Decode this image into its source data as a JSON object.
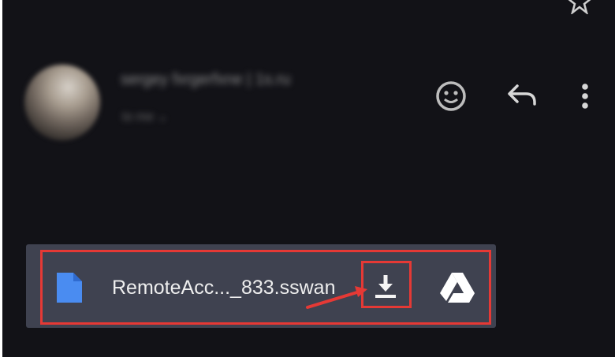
{
  "message": {
    "sender_name": "sergey fxrgerfxne | 1s.ru",
    "sender_meta": "to me ⌄"
  },
  "attachment": {
    "file_name": "RemoteAcc..._833.sswan"
  },
  "icons": {
    "top": "star-icon",
    "actions": [
      "emoji-reaction-icon",
      "reply-icon",
      "more-options-icon"
    ],
    "attachment": [
      "file-icon",
      "download-icon",
      "google-drive-icon"
    ]
  },
  "colors": {
    "background": "#121217",
    "chip_background": "#3f4250",
    "file_icon": "#4a8cf1",
    "highlight": "#e53935",
    "text": "#eeeeee"
  }
}
